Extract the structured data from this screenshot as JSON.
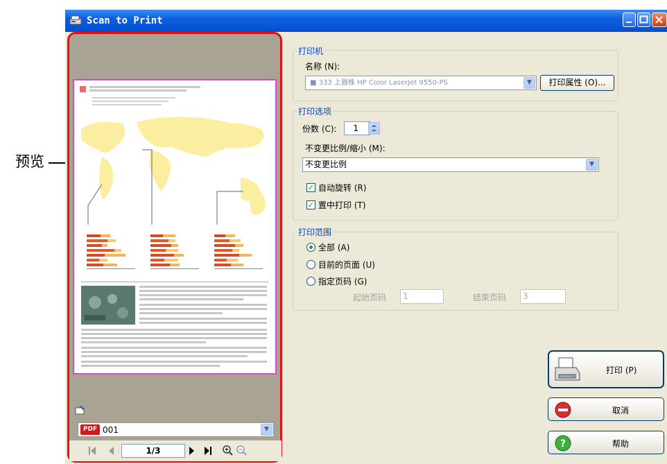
{
  "callout": {
    "label": "预览"
  },
  "window": {
    "title": "Scan to Print"
  },
  "preview": {
    "file_name": "001",
    "file_badge": "PDF",
    "page_indicator": "1/3"
  },
  "printer_group": {
    "legend": "打印机",
    "name_label": "名称 (N):",
    "name_value": "■ 333 上器株 HP Color LaserJet 9550-PS",
    "properties_button": "打印属性 (O)..."
  },
  "options_group": {
    "legend": "打印选项",
    "copies_label": "份数 (C):",
    "copies_value": "1",
    "scale_label": "不变更比例/缩小 (M):",
    "scale_value": "不变更比例",
    "auto_rotate": "自动旋转 (R)",
    "auto_rotate_checked": true,
    "center_print": "置中打印 (T)",
    "center_print_checked": true
  },
  "range_group": {
    "legend": "打印范围",
    "all": "全部 (A)",
    "current": "目前的页面 (U)",
    "specify": "指定页码 (G)",
    "selected": "all",
    "start_label": "起始页码",
    "start_value": "1",
    "end_label": "结束页码",
    "end_value": "3"
  },
  "buttons": {
    "print": "打印 (P)",
    "cancel": "取消",
    "help": "帮助"
  },
  "colors": {
    "preview_frame": "#e01010",
    "page_border": "#d44ad0",
    "titlebar": "#0654d6"
  }
}
